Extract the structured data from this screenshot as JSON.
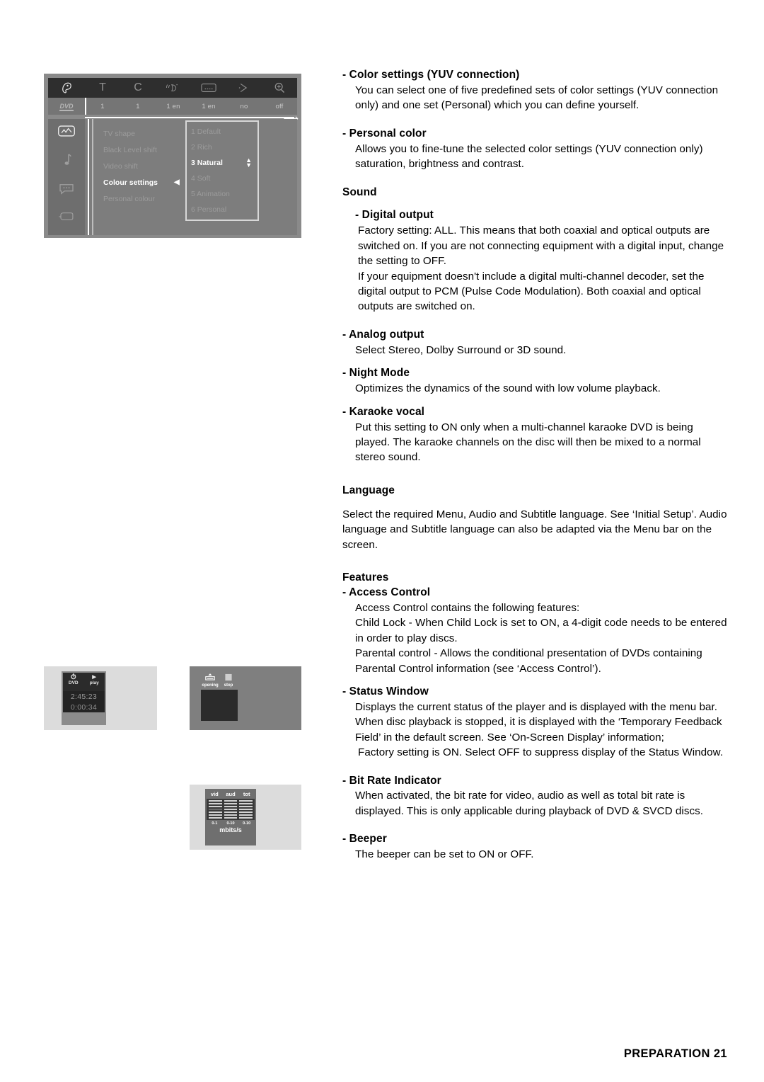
{
  "figures": {
    "osd_menu": {
      "menubar_icons": [
        "disc-icon",
        "title-icon",
        "chapter-icon",
        "audio-icon",
        "subtitle-icon",
        "angle-icon",
        "zoom-icon"
      ],
      "status_values": [
        "1",
        "1",
        "1 en",
        "1 en",
        "no",
        "off"
      ],
      "disc_label": "DVD",
      "sidebar_icons": [
        "picture-icon",
        "sound-icon",
        "language-icon",
        "features-icon"
      ],
      "settings": [
        "TV shape",
        "Black Level shift",
        "Video shift",
        "Colour settings",
        "Personal colour"
      ],
      "selected_setting": "Colour settings",
      "options": [
        "1 Default",
        "2 Rich",
        "3 Natural",
        "4 Soft",
        "5 Animation",
        "6 Personal"
      ],
      "selected_option": "3 Natural"
    },
    "status_window_play": {
      "source": "DVD",
      "state": "play",
      "total_time": "2:45:23",
      "elapsed_time": "0:00:34"
    },
    "status_window_stop": {
      "state_left": "opening",
      "state_right": "stop"
    },
    "bit_rate_indicator": {
      "columns": [
        "vid",
        "aud",
        "tot"
      ],
      "scales": [
        "0-1",
        "0-10",
        "0-10"
      ],
      "unit": "mbits/s"
    }
  },
  "content": {
    "color_settings": {
      "heading": "- Color settings (YUV connection)",
      "body": "You can select one of five predefined sets of color settings (YUV connection only) and one set (Personal) which you can define yourself."
    },
    "personal_color": {
      "heading": "- Personal color",
      "body": "Allows you to fine-tune the selected color settings (YUV connection only) saturation, brightness and contrast."
    },
    "sound": {
      "heading": "Sound",
      "digital_output": {
        "heading": "- Digital output",
        "body1": "Factory setting: ALL. This means that both coaxial and optical outputs are switched on. If you are not connecting equipment with a digital input, change the setting to OFF.",
        "body2": "If your equipment doesn't include a digital multi-channel decoder, set the digital output to PCM (Pulse Code Modulation). Both coaxial and optical outputs are switched on."
      },
      "analog_output": {
        "heading": "- Analog output",
        "body": "Select Stereo, Dolby Surround or 3D sound."
      },
      "night_mode": {
        "heading": "- Night Mode",
        "body": "Optimizes the dynamics of the sound with low volume playback."
      },
      "karaoke_vocal": {
        "heading": "- Karaoke vocal",
        "body": "Put this setting to ON only when a multi-channel karaoke DVD is being played. The karaoke channels on the disc will then be mixed to a normal stereo sound."
      }
    },
    "language": {
      "heading": "Language",
      "body": "Select the required Menu, Audio and Subtitle language. See ‘Initial Setup’. Audio language and Subtitle language can also be adapted via the Menu bar on the screen."
    },
    "features": {
      "heading": "Features",
      "access_control": {
        "heading": "- Access Control",
        "body1": "Access Control contains the following features:",
        "body2": "Child Lock - When Child Lock is set to ON, a 4-digit code needs to be entered in order to play discs.",
        "body3": "Parental control - Allows the conditional presentation of DVDs containing Parental Control information (see ‘Access Control’)."
      },
      "status_window": {
        "heading": "- Status Window",
        "body1": "Displays the current status of the player and is displayed with the menu bar. When disc playback is stopped, it is displayed with the ‘Temporary Feedback Field’ in the default screen. See ‘On-Screen Display’ information;",
        "body2": "Factory setting is ON. Select OFF to suppress display of the Status Window."
      },
      "bit_rate_indicator": {
        "heading": "- Bit Rate Indicator",
        "body": "When activated, the bit rate for video, audio as well as total bit rate is displayed. This is only applicable during playback of DVD & SVCD discs."
      },
      "beeper": {
        "heading": "- Beeper",
        "body": "The beeper can be set to ON or OFF."
      }
    }
  },
  "footer": {
    "text": "PREPARATION 21"
  }
}
